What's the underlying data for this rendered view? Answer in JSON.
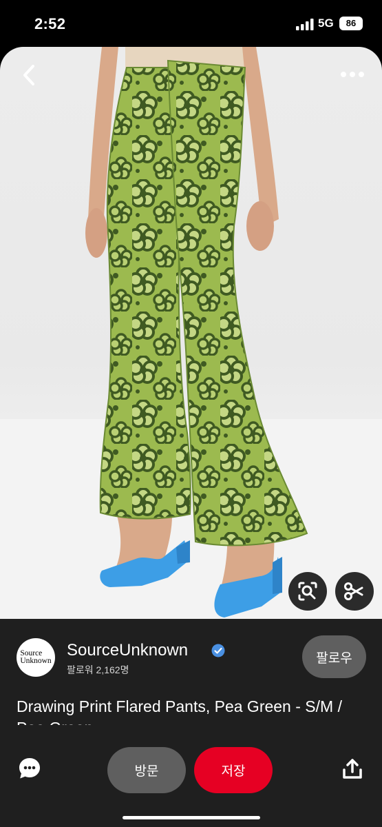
{
  "status_bar": {
    "time": "2:52",
    "network": "5G",
    "battery": "86"
  },
  "pin": {
    "image_subject": "green floral flared pants with blue heeled sandals",
    "back_icon": "chevron-left-icon",
    "more_icon": "more-horizontal-icon",
    "lens_icon": "visual-search-icon",
    "cut_icon": "scissors-icon"
  },
  "creator": {
    "avatar_line1": "Source",
    "avatar_line2": "Unknown",
    "name": "SourceUnknown",
    "followers": "팔로워 2,162명",
    "follow_label": "팔로우"
  },
  "title": "Drawing Print Flared Pants, Pea Green - S/M / Pea Green",
  "actions": {
    "visit_label": "방문",
    "save_label": "저장",
    "comment_icon": "chat-bubble-icon",
    "share_icon": "share-icon"
  },
  "colors": {
    "save_red": "#e60023",
    "sheet_bg": "#1f1f1f",
    "pill_gray": "#5f5f5f",
    "pants_green": "#9cba4f",
    "pattern_dark_green": "#3f5a22",
    "sandal_blue": "#3d9ee6",
    "verified_blue": "#4a90e2"
  }
}
